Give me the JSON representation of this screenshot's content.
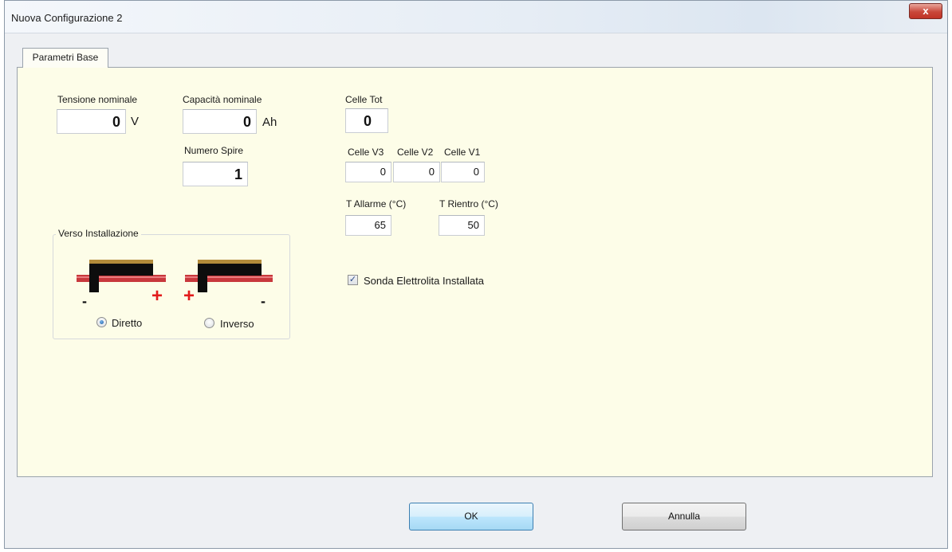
{
  "window": {
    "title": "Nuova Configurazione 2",
    "close_glyph": "x"
  },
  "tabs": [
    {
      "label": "Parametri Base"
    }
  ],
  "fields": {
    "tensione": {
      "label": "Tensione nominale",
      "value": "0",
      "unit": "V"
    },
    "capacita": {
      "label": "Capacità nominale",
      "value": "0",
      "unit": "Ah"
    },
    "spire": {
      "label": "Numero Spire",
      "value": "1"
    },
    "celle_tot": {
      "label": "Celle Tot",
      "value": "0"
    },
    "celle_v3": {
      "label": "Celle V3",
      "value": "0"
    },
    "celle_v2": {
      "label": "Celle V2",
      "value": "0"
    },
    "celle_v1": {
      "label": "Celle V1",
      "value": "0"
    },
    "t_allarme": {
      "label": "T Allarme (°C)",
      "value": "65"
    },
    "t_rientro": {
      "label": "T Rientro (°C)",
      "value": "50"
    }
  },
  "verso": {
    "title": "Verso Installazione",
    "diretto": {
      "label": "Diretto",
      "selected": true,
      "left_sign": "-",
      "right_sign": "+"
    },
    "inverso": {
      "label": "Inverso",
      "selected": false,
      "left_sign": "+",
      "right_sign": "-"
    }
  },
  "sonda": {
    "label": "Sonda Elettrolita Installata",
    "checked": true,
    "check_glyph": "✓"
  },
  "buttons": {
    "ok": "OK",
    "annulla": "Annulla"
  },
  "colors": {
    "panel_bg": "#fdfde8",
    "bar_red": "#c8383c",
    "plus_red": "#e21b1b",
    "block_top": "#b38b3a"
  }
}
